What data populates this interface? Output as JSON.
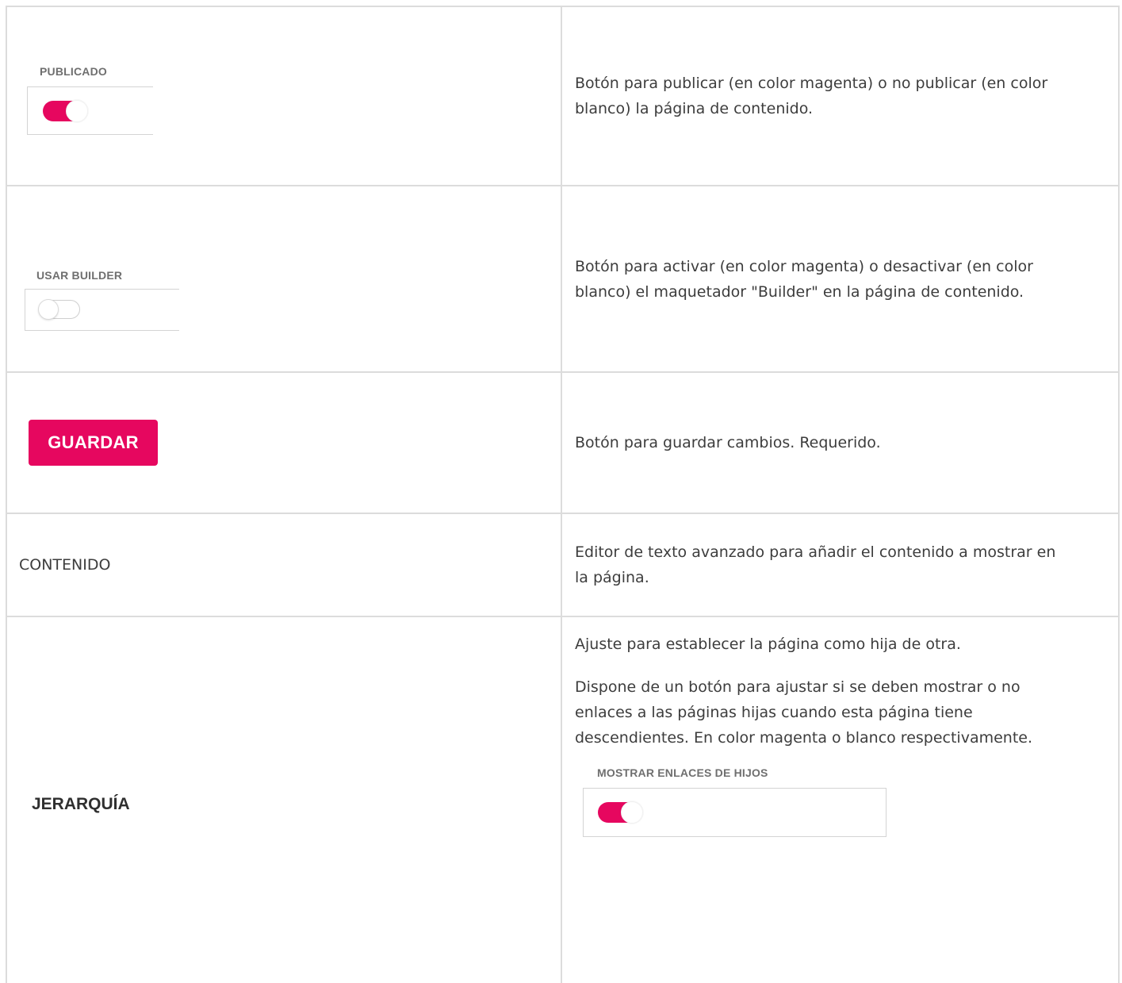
{
  "rows": [
    {
      "label": "PUBLICADO",
      "toggle_state": "on",
      "description": "Botón para publicar (en color magenta)  o no publicar (en color blanco) la página de contenido."
    },
    {
      "label": "USAR BUILDER",
      "toggle_state": "off",
      "description": "Botón para activar  (en color magenta) o desactivar  (en color blanco) el maquetador \"Builder\" en la página de contenido."
    },
    {
      "button_label": "GUARDAR",
      "description": "Botón para guardar cambios. Requerido."
    },
    {
      "label": "CONTENIDO",
      "description": "Editor de texto avanzado para añadir el contenido a mostrar en la página."
    },
    {
      "label": "JERARQUÍA",
      "description_1": "Ajuste para establecer la página como hija de otra.",
      "description_2": "Dispone de un botón para ajustar si se deben mostrar  o no enlaces a las páginas hijas cuando esta página tiene descendientes. En color magenta o blanco respectivamente.",
      "toggle_label": "MOSTRAR ENLACES DE HIJOS",
      "toggle_state": "on"
    }
  ],
  "colors": {
    "accent": "#e6075f",
    "border": "#dcdcdc",
    "text": "#3d3d3d"
  }
}
